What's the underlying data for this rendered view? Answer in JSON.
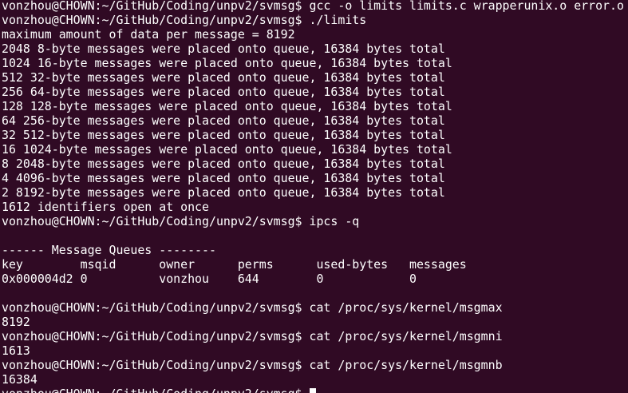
{
  "terminal": {
    "colors": {
      "background": "#300a24",
      "foreground": "#ffffff"
    },
    "lines": [
      "vonzhou@CHOWN:~/GitHub/Coding/unpv2/svmsg$ gcc -o limits limits.c wrapperunix.o error.o",
      "vonzhou@CHOWN:~/GitHub/Coding/unpv2/svmsg$ ./limits",
      "maximum amount of data per message = 8192",
      "2048 8-byte messages were placed onto queue, 16384 bytes total",
      "1024 16-byte messages were placed onto queue, 16384 bytes total",
      "512 32-byte messages were placed onto queue, 16384 bytes total",
      "256 64-byte messages were placed onto queue, 16384 bytes total",
      "128 128-byte messages were placed onto queue, 16384 bytes total",
      "64 256-byte messages were placed onto queue, 16384 bytes total",
      "32 512-byte messages were placed onto queue, 16384 bytes total",
      "16 1024-byte messages were placed onto queue, 16384 bytes total",
      "8 2048-byte messages were placed onto queue, 16384 bytes total",
      "4 4096-byte messages were placed onto queue, 16384 bytes total",
      "2 8192-byte messages were placed onto queue, 16384 bytes total",
      "1612 identifiers open at once",
      "vonzhou@CHOWN:~/GitHub/Coding/unpv2/svmsg$ ipcs -q",
      "",
      "------ Message Queues --------",
      "key        msqid      owner      perms      used-bytes   messages",
      "0x000004d2 0          vonzhou    644        0            0",
      "",
      "vonzhou@CHOWN:~/GitHub/Coding/unpv2/svmsg$ cat /proc/sys/kernel/msgmax",
      "8192",
      "vonzhou@CHOWN:~/GitHub/Coding/unpv2/svmsg$ cat /proc/sys/kernel/msgmni",
      "1613",
      "vonzhou@CHOWN:~/GitHub/Coding/unpv2/svmsg$ cat /proc/sys/kernel/msgmnb",
      "16384"
    ],
    "prompt": "vonzhou@CHOWN:~/GitHub/Coding/unpv2/svmsg$ "
  }
}
